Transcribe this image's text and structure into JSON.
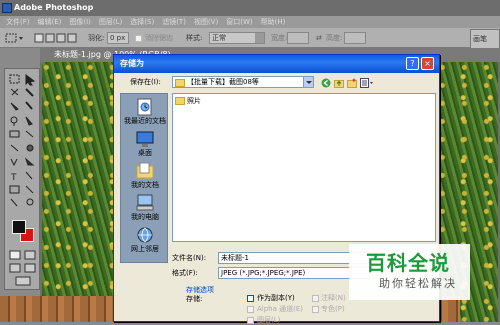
{
  "app": {
    "title": "Adobe Photoshop",
    "menu": [
      "文件(F)",
      "编辑(E)",
      "图像(I)",
      "图层(L)",
      "选择(S)",
      "滤镜(T)",
      "视图(V)",
      "窗口(W)",
      "帮助(H)"
    ]
  },
  "options_bar": {
    "feather_label": "羽化:",
    "feather_value": "0 px",
    "antialias_label": "消除锯齿",
    "style_label": "样式:",
    "style_value": "正常",
    "width_label": "宽度:",
    "height_label": "高度:"
  },
  "panel": {
    "label": "画笔"
  },
  "document": {
    "title": "未标题-1.jpg @ 100% (RGB/8)"
  },
  "dialog": {
    "title": "存储为",
    "save_in_label": "保存在(I):",
    "save_in_value": "【批量下载】截图08等",
    "places": [
      {
        "label": "我最近的文档",
        "icon": "recent-docs-icon"
      },
      {
        "label": "桌面",
        "icon": "desktop-icon"
      },
      {
        "label": "我的文档",
        "icon": "my-documents-icon"
      },
      {
        "label": "我的电脑",
        "icon": "my-computer-icon"
      },
      {
        "label": "网上邻居",
        "icon": "network-places-icon"
      }
    ],
    "files": [
      {
        "name": "照片",
        "icon": "folder-icon"
      }
    ],
    "filename_label": "文件名(N):",
    "filename_value": "未标题-1",
    "format_label": "格式(F):",
    "format_value": "JPEG (*.JPG;*.JPEG;*.JPE)",
    "options_section": "存储选项",
    "store_label": "存储:",
    "options": [
      {
        "label": "作为副本(Y)",
        "enabled": true
      },
      {
        "label": "注释(N)",
        "enabled": false
      },
      {
        "label": "Alpha 通道(E)",
        "enabled": false
      },
      {
        "label": "专色(P)",
        "enabled": false
      },
      {
        "label": "图层(L)",
        "enabled": false
      }
    ]
  },
  "watermark": {
    "big": "百科全说",
    "small": "助你轻松解决",
    "color": "#1c9a3c"
  },
  "colors": {
    "xp_title": "#0a5ce6",
    "foreground": "#111111",
    "background": "#dd1111"
  }
}
